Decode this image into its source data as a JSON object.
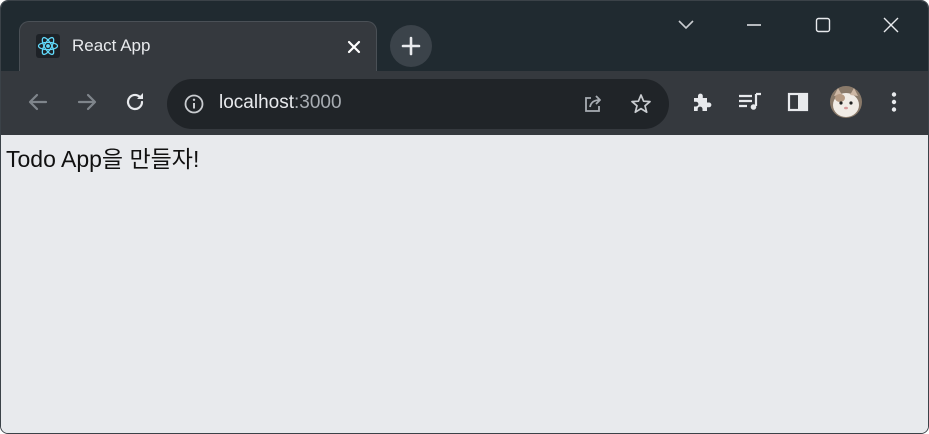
{
  "browser": {
    "tab": {
      "title": "React App",
      "favicon": "react-logo-icon"
    },
    "new_tab_icon": "plus-icon",
    "window_controls": [
      "tab-search-icon",
      "minimize-icon",
      "maximize-icon",
      "close-icon"
    ],
    "toolbar": {
      "back_icon": "arrow-left-icon",
      "forward_icon": "arrow-right-icon",
      "reload_icon": "reload-icon",
      "url_host": "localhost",
      "url_port": ":3000",
      "site_info_icon": "info-icon",
      "share_icon": "share-icon",
      "bookmark_icon": "star-icon",
      "extensions_icon": "puzzle-icon",
      "media_icon": "media-queue-icon",
      "side_panel_icon": "side-panel-icon",
      "profile_icon": "avatar",
      "menu_icon": "kebab-menu-icon"
    },
    "colors": {
      "titlebar": "#202a30",
      "toolbar": "#35393e",
      "omnibox": "#202428",
      "page_background": "#e8eaed",
      "react_blue": "#61dafb"
    }
  },
  "page": {
    "heading": "Todo App을 만들자!"
  }
}
